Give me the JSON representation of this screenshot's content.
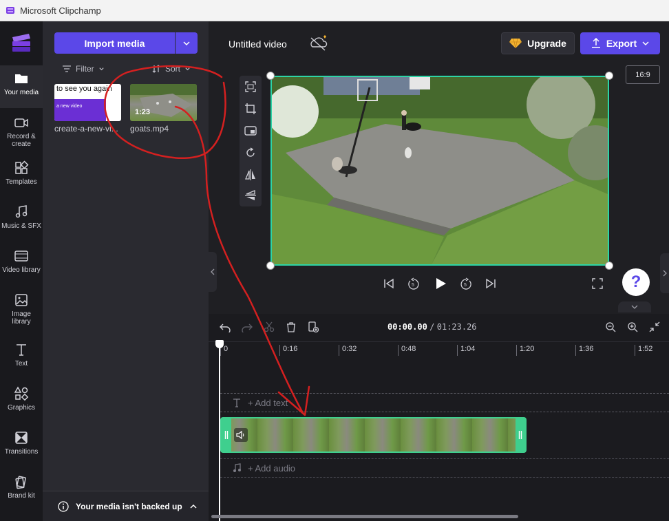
{
  "window": {
    "title": "Microsoft Clipchamp"
  },
  "nav": {
    "items": [
      {
        "label": "Your media",
        "icon": "folder-icon"
      },
      {
        "label": "Record & create",
        "icon": "camera-icon"
      },
      {
        "label": "Templates",
        "icon": "templates-icon"
      },
      {
        "label": "Music & SFX",
        "icon": "music-icon"
      },
      {
        "label": "Video library",
        "icon": "film-icon"
      },
      {
        "label": "Image library",
        "icon": "image-icon"
      },
      {
        "label": "Text",
        "icon": "text-icon"
      },
      {
        "label": "Graphics",
        "icon": "shapes-icon"
      },
      {
        "label": "Transitions",
        "icon": "transitions-icon"
      },
      {
        "label": "Brand kit",
        "icon": "brand-kit-icon"
      }
    ]
  },
  "media": {
    "import_label": "Import media",
    "filter_label": "Filter",
    "sort_label": "Sort",
    "items": [
      {
        "name": "create-a-new-vi...",
        "thumb_text": "to see you again",
        "thumb_sub": "a new video"
      },
      {
        "name": "goats.mp4",
        "duration": "1:23"
      }
    ],
    "backup_text": "Your media isn't backed up"
  },
  "header": {
    "video_title": "Untitled video",
    "upgrade_label": "Upgrade",
    "export_label": "Export",
    "aspect_ratio": "16:9"
  },
  "timeline": {
    "current_time": "00:00.00",
    "separator": "/",
    "total_time": "01:23.26",
    "ticks": [
      "0",
      "0:16",
      "0:32",
      "0:48",
      "1:04",
      "1:20",
      "1:36",
      "1:52"
    ],
    "add_text_label": "+ Add text",
    "add_audio_label": "+ Add audio"
  },
  "help": {
    "label": "?"
  },
  "colors": {
    "accent": "#5b48e8",
    "clip_border": "#3fcf8e",
    "annotation": "#d42020"
  }
}
